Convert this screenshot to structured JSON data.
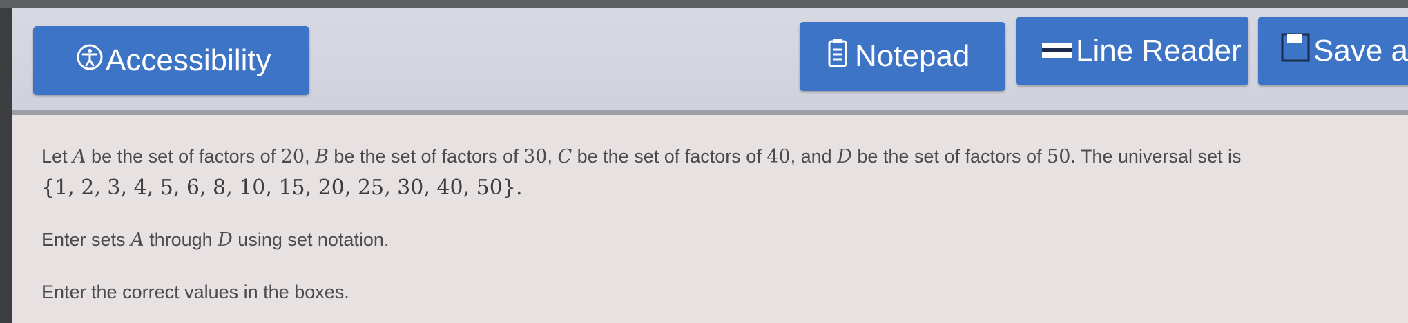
{
  "toolbar": {
    "accessibility": {
      "label": "Accessibility",
      "icon": "accessibility-icon"
    },
    "notepad": {
      "label": "Notepad",
      "icon": "notepad-icon"
    },
    "line_reader": {
      "label": "Line Reader",
      "icon": "line-reader-icon"
    },
    "save": {
      "label": "Save a",
      "icon": "save-icon"
    }
  },
  "colors": {
    "button": "#3d74c6",
    "content_bg": "#e7e2e1",
    "text": "#4a4b4d"
  },
  "question": {
    "intro": {
      "p1": "Let ",
      "A": "A",
      "p2": " be the set of factors of ",
      "n20": "20",
      "p3": ", ",
      "B": "B",
      "p4": " be the set of factors of ",
      "n30": "30",
      "p5": ", ",
      "C": "C",
      "p6": " be the set of factors of ",
      "n40": "40",
      "p7": ", and ",
      "D": "D",
      "p8": " be the set of factors of ",
      "n50": "50",
      "p9": ". The universal set is"
    },
    "universal_set": "{1, 2, 3, 4, 5, 6, 8, 10, 15, 20, 25, 30, 40, 50}.",
    "instruction": {
      "p1": "Enter sets ",
      "A": "A",
      "p2": " through ",
      "D": "D",
      "p3": " using set notation."
    },
    "boxes_instruction": "Enter the correct values in the boxes."
  }
}
